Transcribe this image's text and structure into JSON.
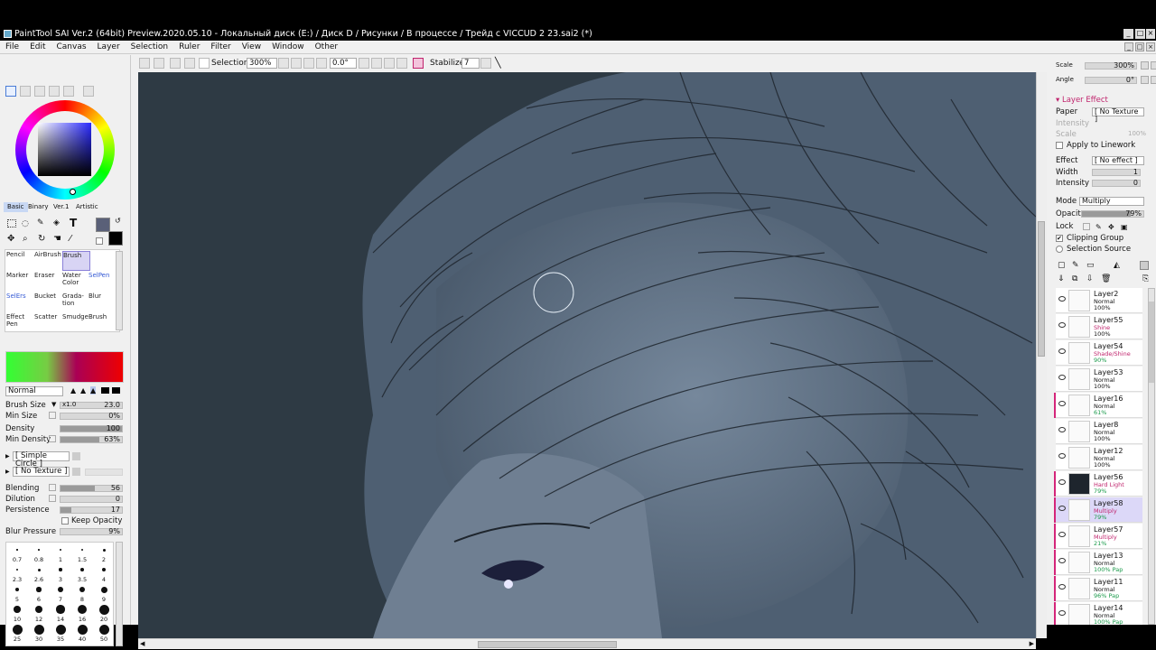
{
  "window": {
    "title": "PaintTool SAI Ver.2 (64bit) Preview.2020.05.10 - Локальный диск (E:) / Диск D / Рисунки / В процессе / Трейд с VICCUD 2 23.sai2 (*)"
  },
  "menu": [
    "File",
    "Edit",
    "Canvas",
    "Layer",
    "Selection",
    "Ruler",
    "Filter",
    "View",
    "Window",
    "Other"
  ],
  "toolbar": {
    "selection_label": "Selection",
    "zoom": "300%",
    "rotation": "0.0°",
    "stabilizer_label": "Stabilizer",
    "stabilizer_value": "7"
  },
  "color_tabs": [
    "Basic",
    "Binary",
    "Ver.1",
    "Artistic"
  ],
  "tools": [
    {
      "label": "Pencil"
    },
    {
      "label": "AirBrush"
    },
    {
      "label": "Brush"
    },
    {
      "label": "Marker"
    },
    {
      "label": "Eraser"
    },
    {
      "label": "Water Color"
    },
    {
      "label": "SelPen"
    },
    {
      "label": "SelErs"
    },
    {
      "label": "Bucket"
    },
    {
      "label": "Grada-tion"
    },
    {
      "label": "Blur"
    },
    {
      "label": "Effect Pen"
    },
    {
      "label": "Scatter"
    },
    {
      "label": "Smudge"
    },
    {
      "label": "Brush"
    }
  ],
  "brush": {
    "blend_mode": "Normal",
    "brush_size_label": "Brush Size",
    "brush_size_mult": "x1.0",
    "brush_size_value": "23.0",
    "min_size_label": "Min Size",
    "min_size_value": "0%",
    "density_label": "Density",
    "density_value": "100",
    "density_fraction": 1.0,
    "min_density_label": "Min Density",
    "min_density_value": "63%",
    "min_density_fraction": 0.63,
    "shape": "[ Simple Circle ]",
    "texture": "[ No Texture ]",
    "blending_label": "Blending",
    "blending_value": "56",
    "blending_fraction": 0.56,
    "dilution_label": "Dilution",
    "dilution_value": "0",
    "persistence_label": "Persistence",
    "persistence_value": "17",
    "persistence_fraction": 0.17,
    "keep_opacity_label": "Keep Opacity",
    "blur_pressure_label": "Blur Pressure",
    "blur_pressure_value": "9%"
  },
  "brush_sizes": [
    "0.7",
    "0.8",
    "1",
    "1.5",
    "2",
    "2.3",
    "2.6",
    "3",
    "3.5",
    "4",
    "5",
    "6",
    "7",
    "8",
    "9",
    "10",
    "12",
    "14",
    "16",
    "20",
    "25",
    "30",
    "35",
    "40",
    "50"
  ],
  "navigator": {
    "scale_label": "Scale",
    "scale_value": "300%",
    "angle_label": "Angle",
    "angle_value": "0°"
  },
  "layer_effect": {
    "header": "Layer Effect",
    "paper_label": "Paper",
    "paper_value": "[ No Texture ]",
    "intensity_label": "Intensity",
    "scale_label": "Scale",
    "scale_value": "100%",
    "apply_linework_label": "Apply to Linework",
    "effect_label": "Effect",
    "effect_value": "[ No effect ]",
    "width_label": "Width",
    "width_value": "1",
    "effect_intensity_label": "Intensity",
    "effect_intensity_value": "0"
  },
  "layer_props": {
    "mode_label": "Mode",
    "mode_value": "Multiply",
    "opacity_label": "Opacity",
    "opacity_value": "79%",
    "opacity_fraction": 0.79,
    "lock_label": "Lock",
    "clipping_group_label": "Clipping Group",
    "selection_source_label": "Selection Source"
  },
  "layers": [
    {
      "name": "Layer2",
      "mode": "Normal",
      "opacity": "100%",
      "clip": false,
      "selected": false
    },
    {
      "name": "Layer55",
      "mode": "Shine",
      "opacity": "100%",
      "clip": false,
      "selected": false
    },
    {
      "name": "Layer54",
      "mode": "Shade/Shine",
      "opacity": "90%",
      "clip": false,
      "selected": false
    },
    {
      "name": "Layer53",
      "mode": "Normal",
      "opacity": "100%",
      "clip": false,
      "selected": false
    },
    {
      "name": "Layer16",
      "mode": "Normal",
      "opacity": "61%",
      "clip": true,
      "selected": false
    },
    {
      "name": "Layer8",
      "mode": "Normal",
      "opacity": "100%",
      "clip": false,
      "selected": false
    },
    {
      "name": "Layer12",
      "mode": "Normal",
      "opacity": "100%",
      "clip": false,
      "selected": false
    },
    {
      "name": "Layer56",
      "mode": "Hard Light",
      "opacity": "79%",
      "clip": true,
      "selected": false
    },
    {
      "name": "Layer58",
      "mode": "Multiply",
      "opacity": "79%",
      "clip": true,
      "selected": true
    },
    {
      "name": "Layer57",
      "mode": "Multiply",
      "opacity": "21%",
      "clip": true,
      "selected": false
    },
    {
      "name": "Layer13",
      "mode": "Normal",
      "opacity": "100% Pap",
      "clip": true,
      "selected": false
    },
    {
      "name": "Layer11",
      "mode": "Normal",
      "opacity": "96% Pap",
      "clip": true,
      "selected": false
    },
    {
      "name": "Layer14",
      "mode": "Normal",
      "opacity": "100% Pap",
      "clip": true,
      "selected": false
    }
  ],
  "colors": {
    "canvas_bg": "#2e3a44",
    "hair": "#4e5f72",
    "clip_bar": "#d4257a",
    "selected_layer": "#dcd8f8",
    "primary_swatch": "#5a6078"
  }
}
